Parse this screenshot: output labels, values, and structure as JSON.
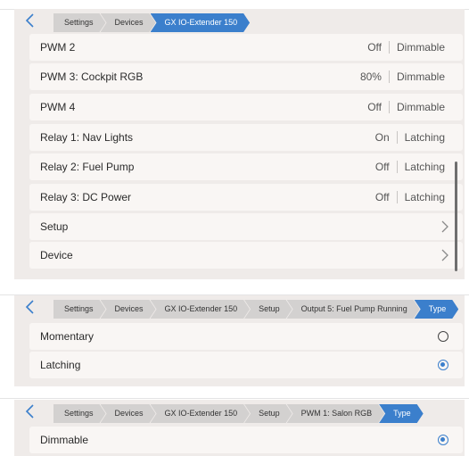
{
  "screen1": {
    "breadcrumb": [
      "Settings",
      "Devices",
      "GX IO-Extender 150"
    ],
    "rows": [
      {
        "label": "PWM 2",
        "value": "Off",
        "kind": "Dimmable"
      },
      {
        "label": "PWM 3: Cockpit RGB",
        "value": "80%",
        "kind": "Dimmable"
      },
      {
        "label": "PWM 4",
        "value": "Off",
        "kind": "Dimmable"
      },
      {
        "label": "Relay 1: Nav Lights",
        "value": "On",
        "kind": "Latching"
      },
      {
        "label": "Relay 2: Fuel Pump",
        "value": "Off",
        "kind": "Latching"
      },
      {
        "label": "Relay 3: DC Power",
        "value": "Off",
        "kind": "Latching"
      },
      {
        "label": "Setup"
      },
      {
        "label": "Device"
      }
    ]
  },
  "screen2": {
    "breadcrumb": [
      "Settings",
      "Devices",
      "GX IO-Extender 150",
      "Setup",
      "Output 5: Fuel Pump Running",
      "Type"
    ],
    "options": [
      {
        "label": "Momentary",
        "selected": false
      },
      {
        "label": "Latching",
        "selected": true
      }
    ]
  },
  "screen3": {
    "breadcrumb": [
      "Settings",
      "Devices",
      "GX IO-Extender 150",
      "Setup",
      "PWM 1: Salon RGB",
      "Type"
    ],
    "options": [
      {
        "label": "Dimmable",
        "selected": true
      }
    ]
  },
  "colors": {
    "accent": "#3b7fcc",
    "panel": "#efebe9",
    "row": "#f9f6f4",
    "crumb": "#d3d1d0"
  },
  "icons": {
    "back": "chevron-left-icon",
    "forward": "chevron-right-icon"
  }
}
